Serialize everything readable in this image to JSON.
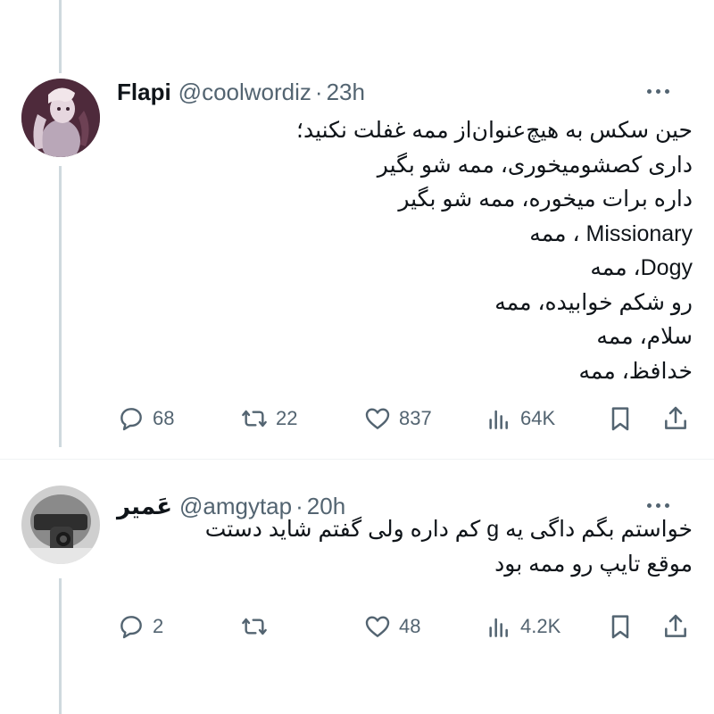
{
  "tweets": [
    {
      "name": "Flapi",
      "handle": "@coolwordiz",
      "time": "23h",
      "lines": [
        "حین سکس به هیچ‌عنوان‌از ممه غفلت نکنید؛",
        "داری کصشومیخوری، ممه شو بگیر",
        "داره برات میخوره، ممه شو بگیر",
        "Missionary ، ممه",
        "Dogy، ممه",
        "رو شکم خوابیده، ممه",
        "سلام، ممه",
        "خدافظ، ممه"
      ],
      "stats": {
        "replies": "68",
        "retweets": "22",
        "likes": "837",
        "views": "64K"
      }
    },
    {
      "name": "عَمیر",
      "handle": "@amgytap",
      "time": "20h",
      "lines": [
        "خواستم بگم داگی یه g کم داره ولی گفتم شاید دستت",
        "موقع تایپ رو ممه بود"
      ],
      "stats": {
        "replies": "2",
        "retweets": "",
        "likes": "48",
        "views": "4.2K"
      }
    }
  ],
  "icons": {
    "reply": "reply-icon",
    "retweet": "retweet-icon",
    "like": "like-icon",
    "views": "views-icon",
    "bookmark": "bookmark-icon",
    "share": "share-icon",
    "more": "more-icon"
  },
  "colors": {
    "icon_gray": "#536471",
    "text": "#0f1419",
    "thread_line": "#cfd9de"
  }
}
